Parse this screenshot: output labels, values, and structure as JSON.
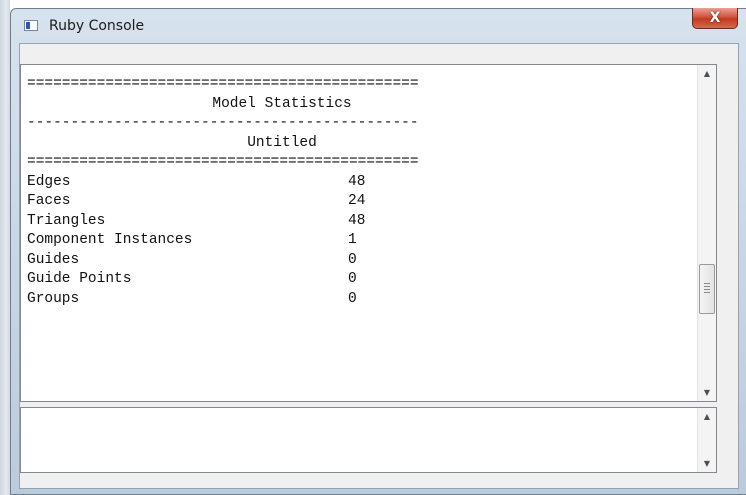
{
  "window": {
    "title": "Ruby Console",
    "close_glyph": "X"
  },
  "output": {
    "lines": {
      "rule_double": "=============================================",
      "heading": "Model Statistics",
      "rule_single": "---------------------------------------------",
      "model_name": "Untitled"
    },
    "stats": [
      {
        "label": "Edges",
        "value": "48"
      },
      {
        "label": "Faces",
        "value": "24"
      },
      {
        "label": "Triangles",
        "value": "48"
      },
      {
        "label": "Component Instances",
        "value": "1"
      },
      {
        "label": "Guides",
        "value": "0"
      },
      {
        "label": "Guide Points",
        "value": "0"
      },
      {
        "label": "Groups",
        "value": "0"
      }
    ],
    "scrollbar": {
      "up_glyph": "▲",
      "down_glyph": "▼",
      "position": 0.78
    }
  },
  "input": {
    "value": "",
    "scrollbar": {
      "up_glyph": "▲",
      "down_glyph": "▼"
    }
  },
  "colors": {
    "close_button": "#c94a32",
    "text": "#111111"
  }
}
